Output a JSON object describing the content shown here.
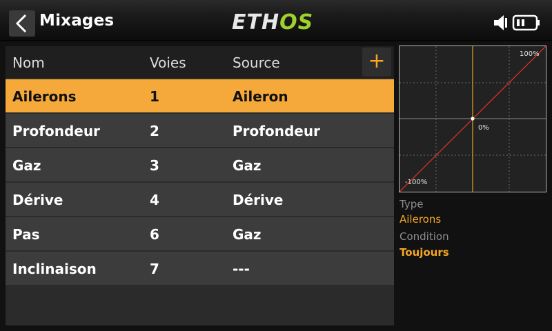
{
  "header": {
    "title": "Mixages",
    "logo_left": "ETH",
    "logo_right": "OS",
    "icons": [
      "back-arrow-icon",
      "volume-icon",
      "battery-icon"
    ]
  },
  "table": {
    "columns": [
      "Nom",
      "Voies",
      "Source"
    ],
    "add_label": "+",
    "rows": [
      {
        "name": "Ailerons",
        "channel": "1",
        "source": "Aileron",
        "selected": true
      },
      {
        "name": "Profondeur",
        "channel": "2",
        "source": "Profondeur",
        "selected": false
      },
      {
        "name": "Gaz",
        "channel": "3",
        "source": "Gaz",
        "selected": false
      },
      {
        "name": "Dérive",
        "channel": "4",
        "source": "Dérive",
        "selected": false
      },
      {
        "name": "Pas",
        "channel": "6",
        "source": "Gaz",
        "selected": false
      },
      {
        "name": "Inclinaison",
        "channel": "7",
        "source": "---",
        "selected": false
      }
    ]
  },
  "graph": {
    "label_max": "100%",
    "label_zero": "0%",
    "label_min": "-100%"
  },
  "details": {
    "type_label": "Type",
    "type_value": "Ailerons",
    "condition_label": "Condition",
    "condition_value": "Toujours"
  },
  "colors": {
    "accent": "#f5a623",
    "selected_row": "#f5a93a",
    "curve": "#d9302a",
    "logo_green": "#9fd12c"
  }
}
